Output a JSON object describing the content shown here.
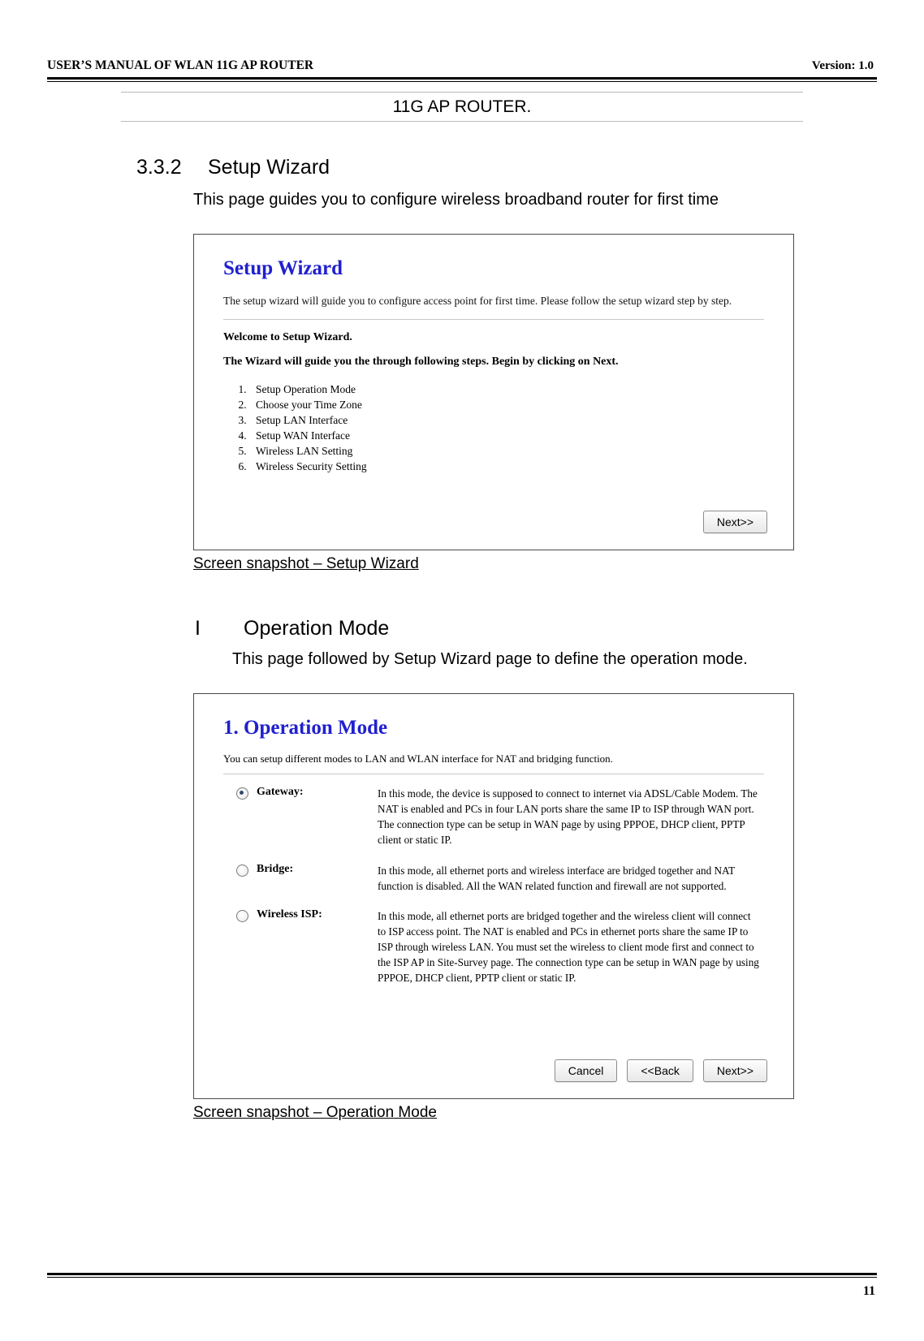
{
  "header": {
    "left": "USER’S MANUAL OF WLAN 11G AP ROUTER",
    "right": "Version: 1.0"
  },
  "doc_title": "11G AP ROUTER.",
  "section": {
    "number": "3.3.2",
    "title": "Setup Wizard",
    "description": "This page guides you to configure wireless broadband router for first time"
  },
  "wizard_shot": {
    "title": "Setup Wizard",
    "intro": "The setup wizard will guide you to configure access point for first time. Please follow the setup wizard step by step.",
    "welcome": "Welcome to Setup Wizard.",
    "guide": "The Wizard will guide you the through following steps. Begin by clicking on Next.",
    "steps": [
      "Setup Operation Mode",
      "Choose your Time Zone",
      "Setup LAN Interface",
      "Setup WAN Interface",
      "Wireless LAN Setting",
      "Wireless Security Setting"
    ],
    "next_label": "Next>>"
  },
  "wizard_caption": "Screen snapshot – Setup Wizard",
  "subsection": {
    "number": "I",
    "title": "Operation Mode",
    "description": "This page followed by Setup Wizard page to define the operation mode."
  },
  "opmode_shot": {
    "title": "1. Operation Mode",
    "intro": "You can setup different modes to LAN and WLAN interface for NAT and bridging function.",
    "modes": [
      {
        "label": "Gateway:",
        "selected": true,
        "text": "In this mode, the device is supposed to connect to internet via ADSL/Cable Modem. The NAT is enabled and PCs in four LAN ports share the same IP to ISP through WAN port. The connection type can be setup in WAN page by using PPPOE, DHCP client, PPTP client or static IP."
      },
      {
        "label": "Bridge:",
        "selected": false,
        "text": "In this mode, all ethernet ports and wireless interface are bridged together and NAT function is disabled. All the WAN related function and firewall are not supported."
      },
      {
        "label": "Wireless ISP:",
        "selected": false,
        "text": "In this mode, all ethernet ports are bridged together and the wireless client will connect to ISP access point. The NAT is enabled and PCs in ethernet ports share the same IP to ISP through wireless LAN. You must set the wireless to client mode first and connect to the ISP AP in Site-Survey page. The connection type can be setup in WAN page by using PPPOE, DHCP client, PPTP client or static IP."
      }
    ],
    "cancel_label": "Cancel",
    "back_label": "<<Back",
    "next_label": "Next>>"
  },
  "opmode_caption": "Screen snapshot – Operation Mode",
  "footer": {
    "page_number": "11"
  }
}
